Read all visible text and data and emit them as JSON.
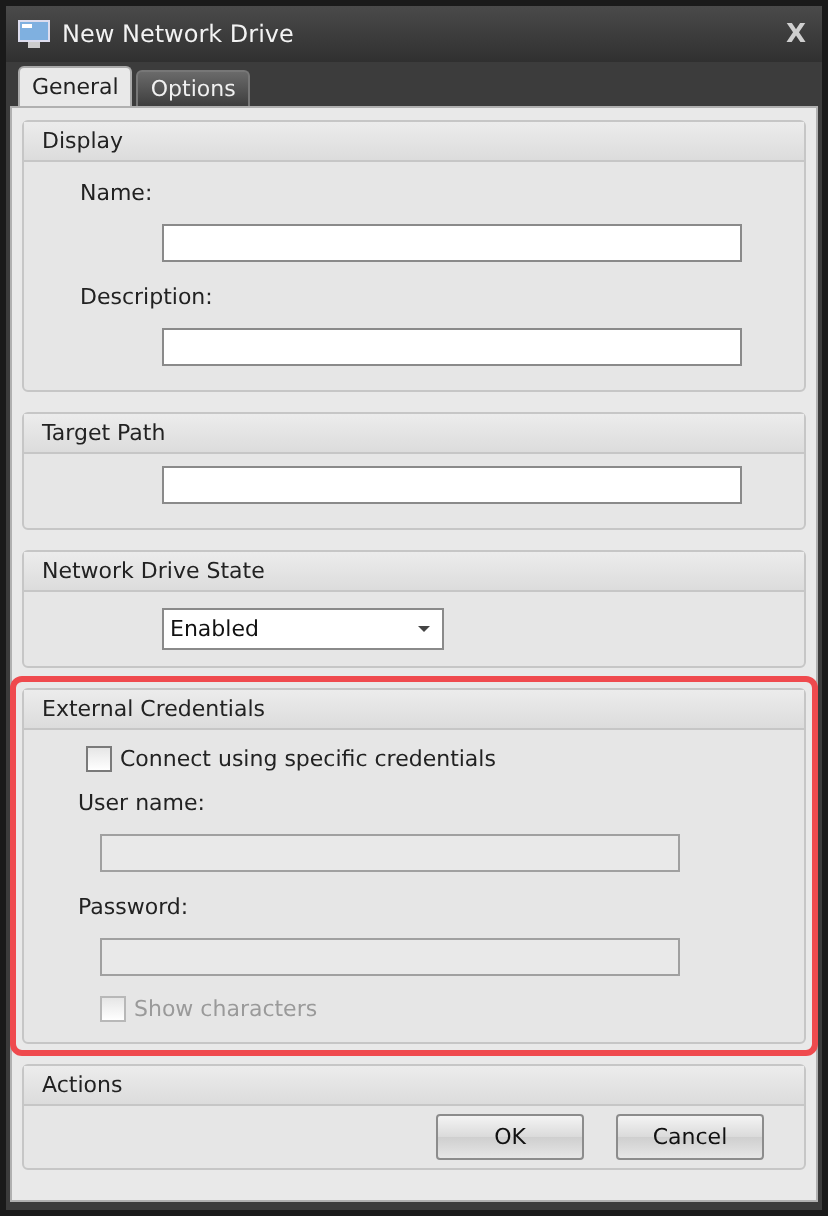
{
  "window": {
    "title": "New Network Drive",
    "close": "X"
  },
  "tabs": [
    {
      "label": "General",
      "selected": true
    },
    {
      "label": "Options",
      "selected": false
    }
  ],
  "sections": [
    {
      "title": "Display",
      "highlighted": false,
      "rows": [
        {
          "kind": "label",
          "text": "Name:"
        },
        {
          "kind": "field",
          "disabled": false
        },
        {
          "kind": "label",
          "text": "Description:"
        },
        {
          "kind": "field",
          "disabled": false
        }
      ]
    },
    {
      "title": "Target Path",
      "highlighted": false,
      "rows": [
        {
          "kind": "field",
          "disabled": false
        }
      ]
    },
    {
      "title": "Network Drive State",
      "highlighted": false,
      "rows": [
        {
          "kind": "dropdown",
          "value": "Enabled"
        }
      ]
    },
    {
      "title": "External Credentials",
      "highlighted": true,
      "rows": [
        {
          "kind": "checkbox",
          "label": "Connect using specific credentials",
          "checked": false,
          "disabled": false,
          "children": [
            {
              "kind": "label",
              "text": "User name:"
            },
            {
              "kind": "field",
              "disabled": true
            },
            {
              "kind": "label",
              "text": "Password:"
            },
            {
              "kind": "field",
              "disabled": true
            },
            {
              "kind": "checkbox",
              "label": "Show characters",
              "checked": false,
              "disabled": true
            }
          ]
        }
      ]
    },
    {
      "title": "Actions",
      "highlighted": false,
      "rows": [
        {
          "kind": "buttons",
          "buttons": [
            "OK",
            "Cancel"
          ]
        }
      ]
    }
  ]
}
